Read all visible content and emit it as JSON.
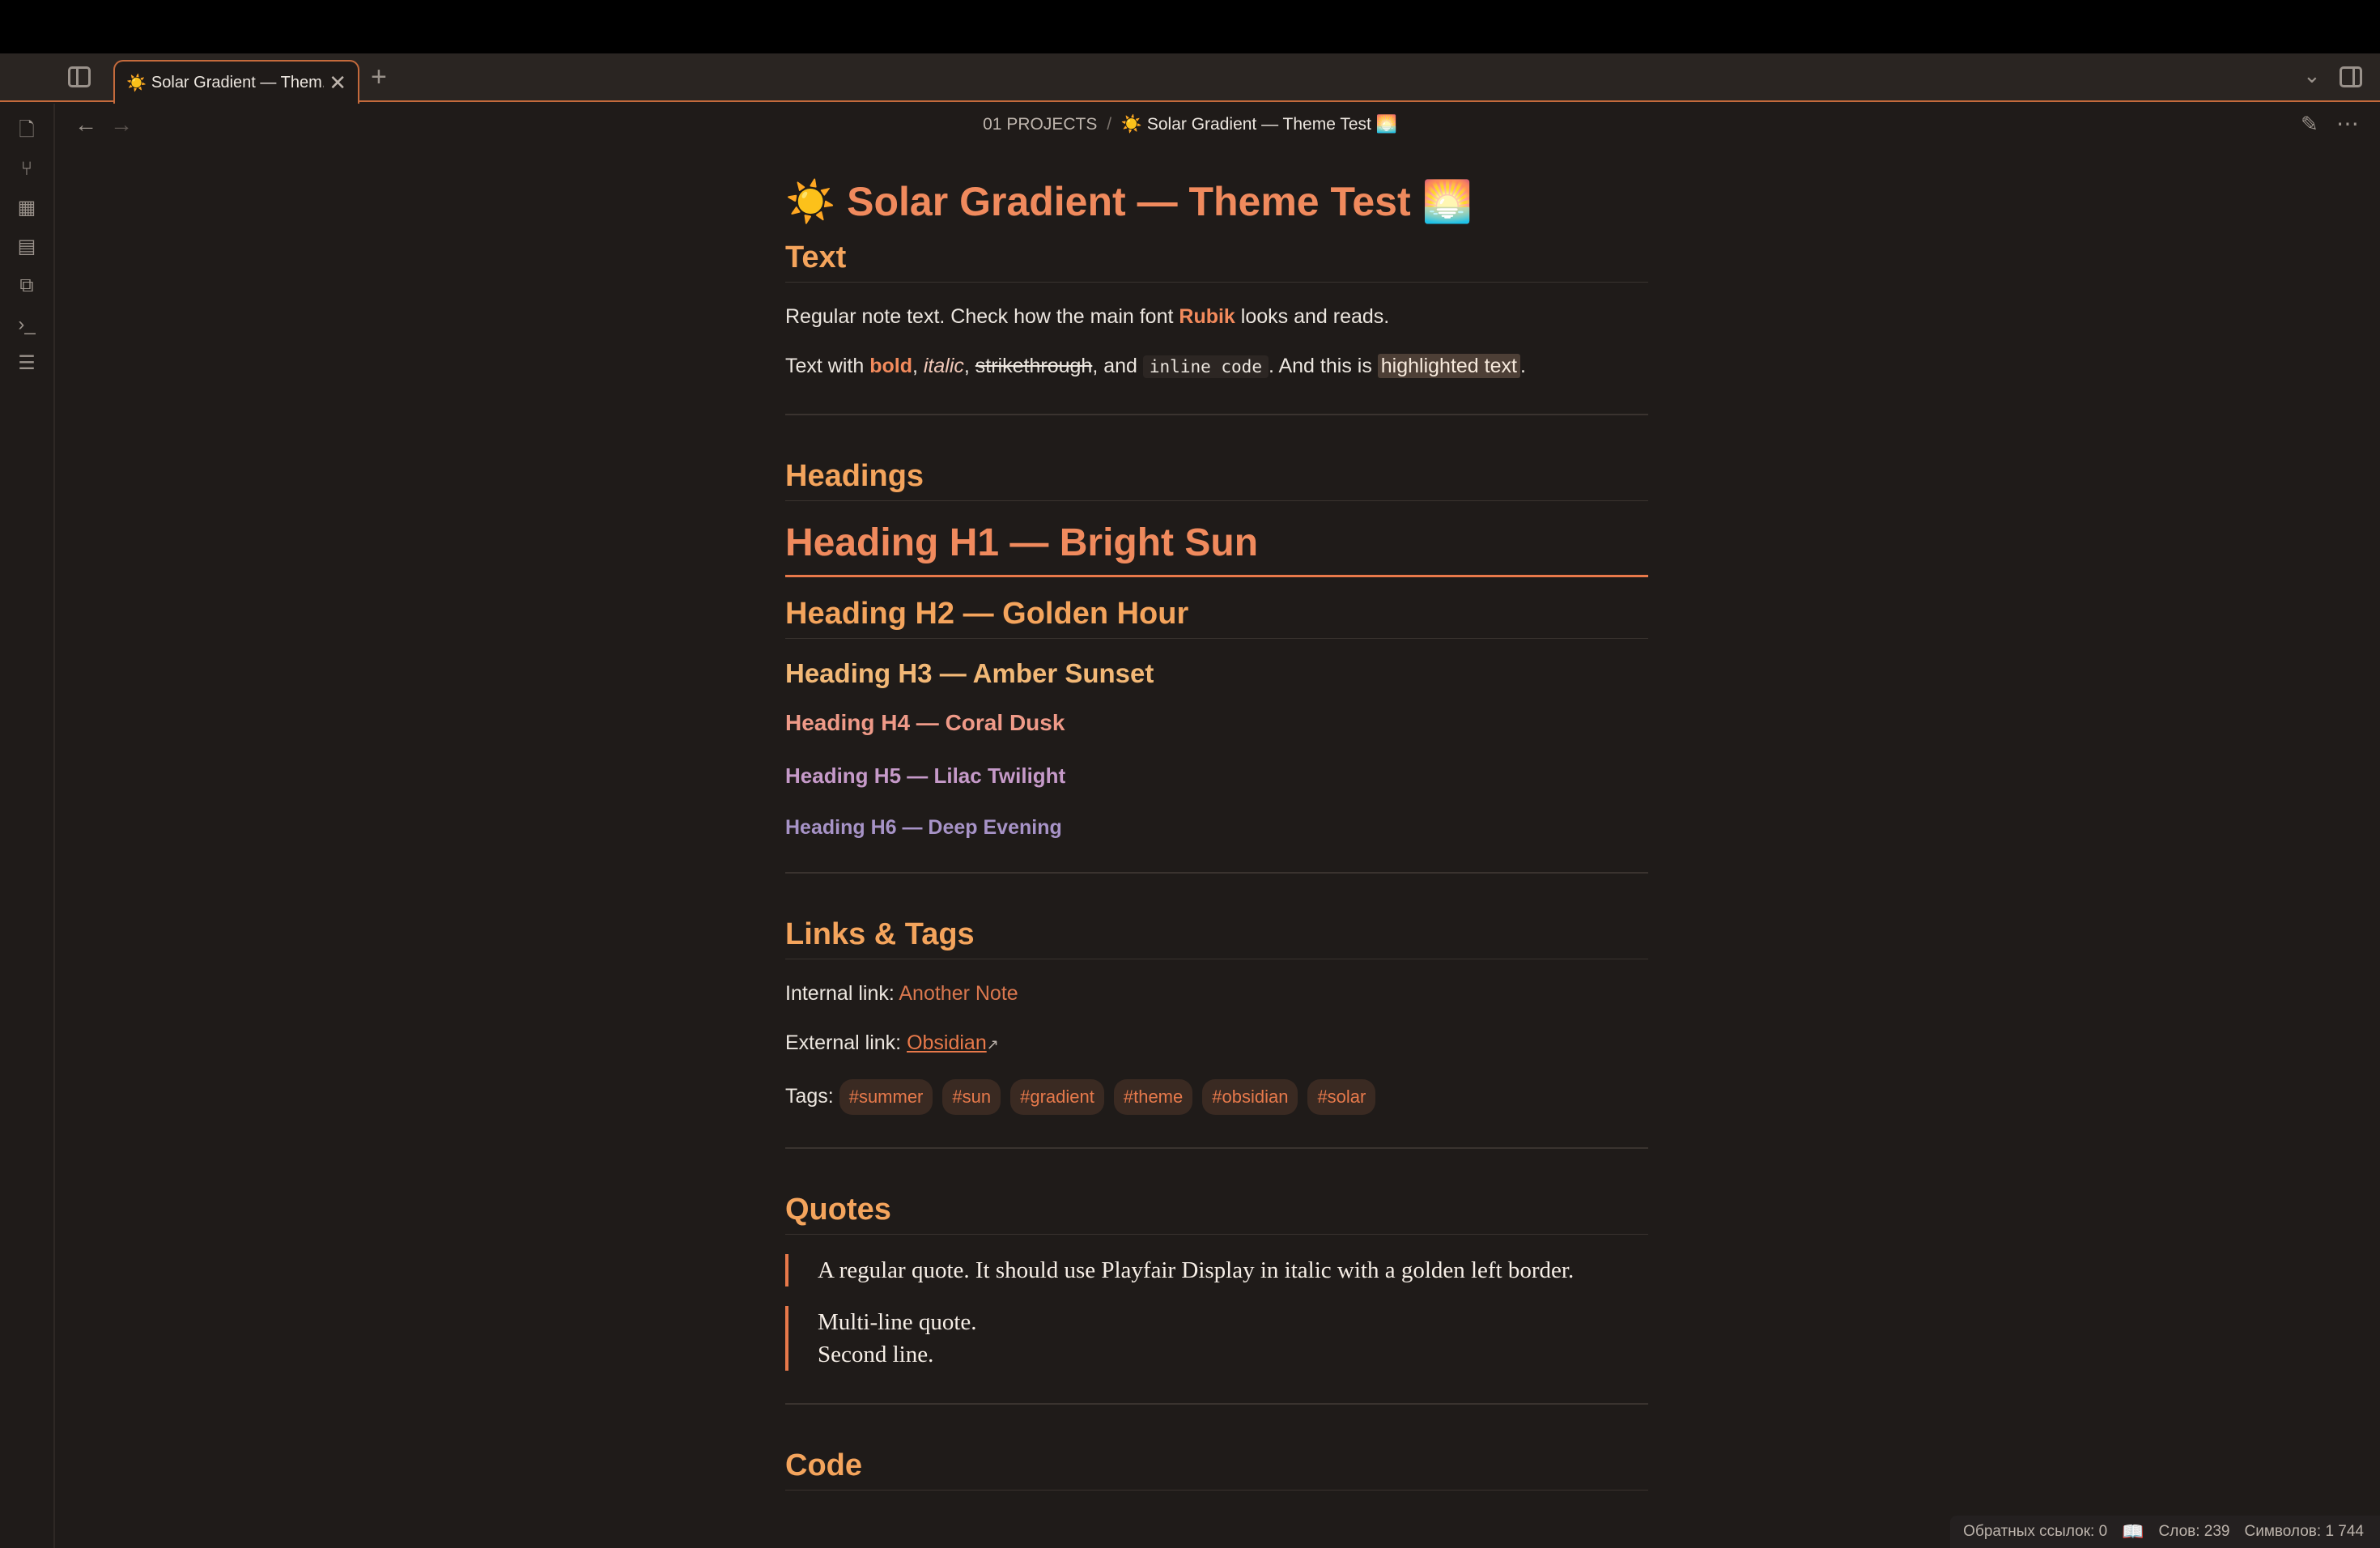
{
  "tabbar": {
    "tab_emoji": "☀️",
    "tab_title": "Solar Gradient — Them...",
    "close_glyph": "✕",
    "new_tab_glyph": "+",
    "dropdown_glyph": "⌄"
  },
  "nav": {
    "back_glyph": "←",
    "forward_glyph": "→",
    "breadcrumb_folder": "01 PROJECTS",
    "breadcrumb_sep": "/",
    "breadcrumb_current": "☀️ Solar Gradient — Theme Test 🌅",
    "edit_glyph": "✎",
    "more_glyph": "⋯"
  },
  "ribbon": {
    "icons": [
      "file-icon",
      "graph-icon",
      "grid-icon",
      "calendar-icon",
      "copy-icon",
      "terminal-icon",
      "list-icon"
    ]
  },
  "note": {
    "title": "☀️ Solar Gradient — Theme Test 🌅",
    "sec_text": "Text",
    "p1_a": "Regular note text. Check how the main font ",
    "p1_font": "Rubik",
    "p1_b": " looks and reads.",
    "p2_a": "Text with ",
    "p2_bold": "bold",
    "p2_c1": ", ",
    "p2_italic": "italic",
    "p2_c2": ", ",
    "p2_strike": "strikethrough",
    "p2_c3": ", and ",
    "p2_code": "inline code",
    "p2_c4": ". And this is ",
    "p2_mark": "highlighted text",
    "p2_end": ".",
    "sec_headings": "Headings",
    "h1": "Heading H1 — Bright Sun",
    "h2": "Heading H2 — Golden Hour",
    "h3": "Heading H3 — Amber Sunset",
    "h4": "Heading H4 — Coral Dusk",
    "h5": "Heading H5 — Lilac Twilight",
    "h6": "Heading H6 — Deep Evening",
    "sec_links": "Links & Tags",
    "internal_label": "Internal link: ",
    "internal_link": "Another Note",
    "external_label": "External link: ",
    "external_link": "Obsidian",
    "external_icon": "↗",
    "tags_label": "Tags: ",
    "tags": [
      "#summer",
      "#sun",
      "#gradient",
      "#theme",
      "#obsidian",
      "#solar"
    ],
    "sec_quotes": "Quotes",
    "quote1": "A regular quote. It should use Playfair Display in italic with a golden left border.",
    "quote2_line1": "Multi-line quote.",
    "quote2_line2": "Second line.",
    "sec_code": "Code"
  },
  "status": {
    "backlinks": "Обратных ссылок: 0",
    "reading_glyph": "📖",
    "words": "Слов: 239",
    "chars": "Символов: 1 744"
  },
  "colors": {
    "accent": "#e8794a",
    "background": "#1f1b19",
    "h1": "#f08a5d",
    "h2": "#f4a45c",
    "h3": "#f2b876",
    "h4": "#ef9a88",
    "h5": "#c69ac9",
    "h6": "#a793c7"
  }
}
